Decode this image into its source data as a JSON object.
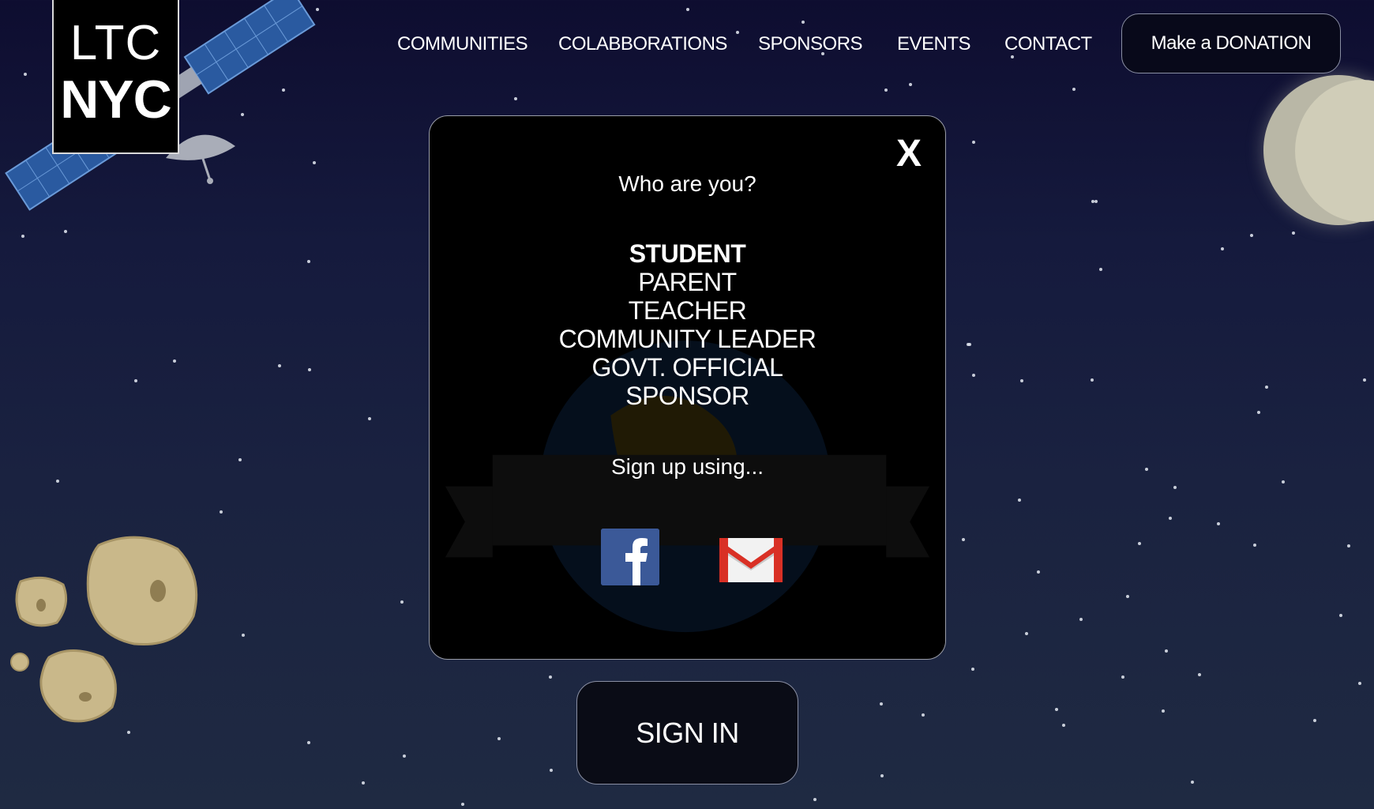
{
  "logo": {
    "line1": "LTC",
    "line2": "NYC"
  },
  "nav": {
    "items": [
      "COMMUNITIES",
      "COLABBORATIONS",
      "SPONSORS",
      "EVENTS",
      "CONTACT"
    ],
    "donate_label": "Make a DONATION"
  },
  "modal": {
    "close_label": "X",
    "question": "Who are you?",
    "roles": [
      "STUDENT",
      "PARENT",
      "TEACHER",
      "COMMUNITY LEADER",
      "GOVT. OFFICIAL",
      "SPONSOR"
    ],
    "selected_role": "STUDENT",
    "signup_text": "Sign up using...",
    "signup_options": [
      "facebook-icon",
      "gmail-icon"
    ]
  },
  "signin_label": "SIGN IN",
  "colors": {
    "facebook": "#3b5998",
    "gmail_red": "#d93025",
    "background_top": "#0e0d30",
    "background_bottom": "#1f2a42"
  }
}
